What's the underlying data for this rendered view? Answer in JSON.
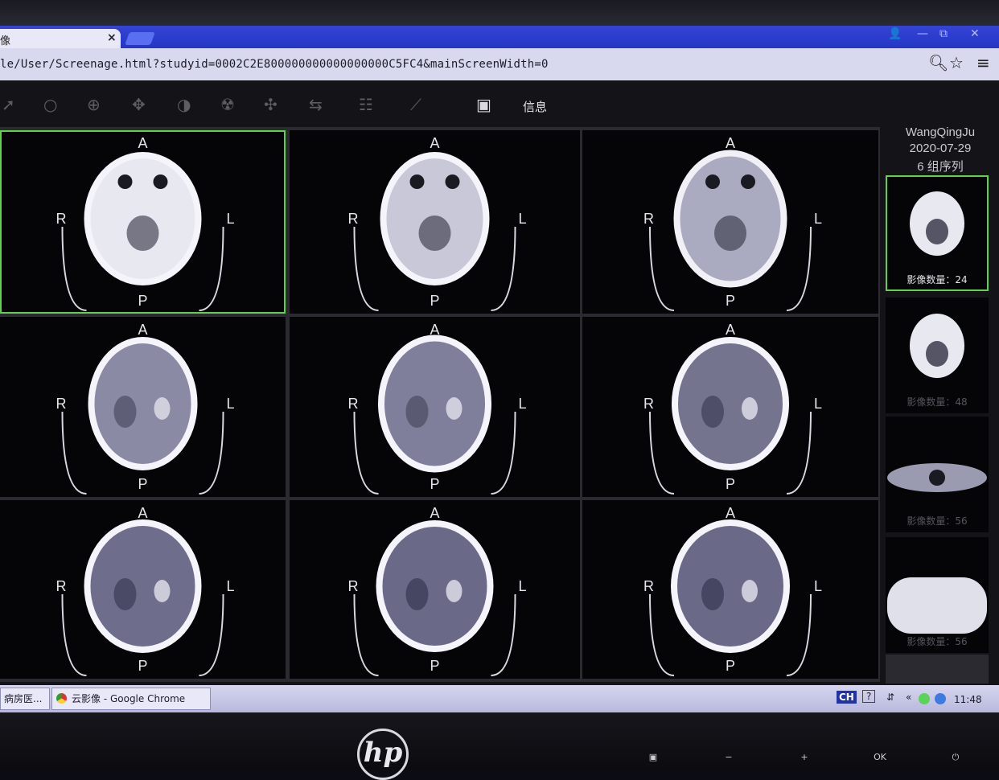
{
  "browser": {
    "tab_title": "像",
    "tab_close": "×",
    "url": "le/User/Screenage.html?studyid=0002C2E800000000000000000C5FC4&mainScreenWidth=0",
    "window_controls": [
      "👤",
      "—",
      "⧉",
      "✕"
    ]
  },
  "toolbar": {
    "icons": [
      "pointer-icon",
      "zoom-icon",
      "magnify-icon",
      "pan-icon",
      "window-level-icon",
      "radiation-icon",
      "move-icon",
      "flip-icon",
      "adjust-icon",
      "measure-icon",
      "save-icon"
    ],
    "info_label": "信息"
  },
  "viewer": {
    "orientation": {
      "top": "A",
      "bottom": "P",
      "left": "R",
      "right": "L"
    },
    "selected_cell": 0
  },
  "sidebar": {
    "patient_name": "WangQingJu",
    "study_date": "2020-07-29",
    "series_count_label": "6 组序列",
    "series": [
      {
        "count_label": "影像数量：24",
        "selected": true
      },
      {
        "count_label": "影像数量：48",
        "selected": false
      },
      {
        "count_label": "影像数量：56",
        "selected": false
      },
      {
        "count_label": "影像数量：56",
        "selected": false
      }
    ]
  },
  "taskbar": {
    "task1": "病房医...",
    "task2": "云影像 - Google Chrome",
    "ime": "CH",
    "help": "?",
    "clock": "11:48"
  },
  "monitor": {
    "logo": "hp",
    "buttons": [
      "▣",
      "−",
      "+",
      "OK",
      "⏻"
    ]
  }
}
